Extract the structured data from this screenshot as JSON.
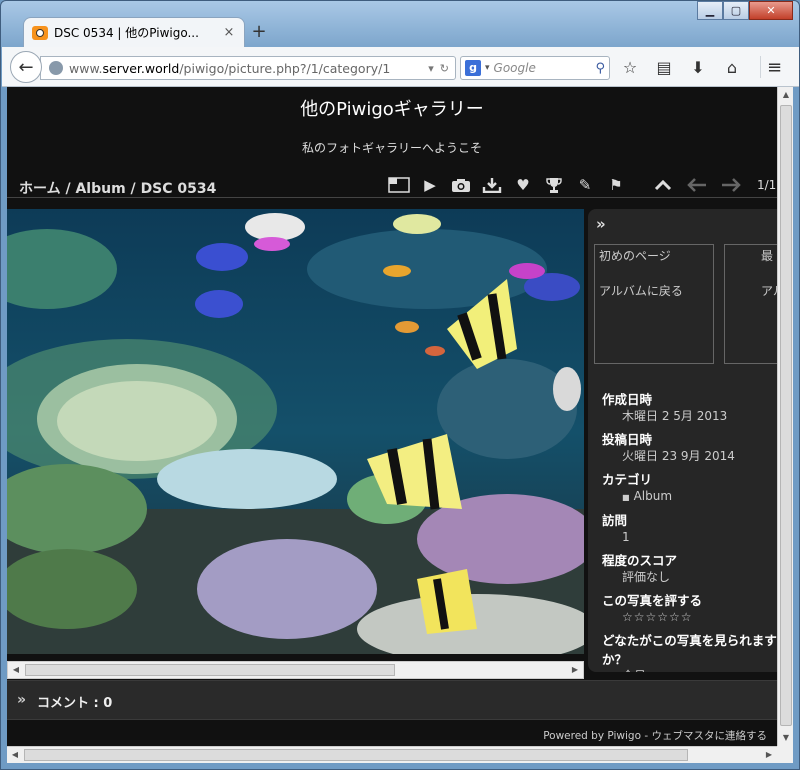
{
  "browser": {
    "tab_title": "DSC 0534 | 他のPiwigo...",
    "new_tab": "+",
    "tab_close": "×",
    "url_prefix": "www.",
    "url_host": "server.world",
    "url_path": "/piwigo/picture.php?/1/category/1",
    "search_engine_letter": "g",
    "search_placeholder": "Google",
    "window_min": "▁",
    "window_max": "▢",
    "window_close": "✕"
  },
  "site": {
    "title": "他のPiwigoギャラリー",
    "subtitle": "私のフォトギャラリーへようこそ"
  },
  "breadcrumb": {
    "home": "ホーム",
    "sep1": " / ",
    "album": "Album",
    "sep2": " / ",
    "current": "DSC 0534"
  },
  "nav": {
    "counter": "1/1"
  },
  "info_panel": {
    "first_page": "初めのページ",
    "back_to_album": "アルバムに戻る",
    "last_page": "最",
    "last_album": "アル",
    "created_label": "作成日時",
    "created_value": "木曜日 2 5月 2013",
    "posted_label": "投稿日時",
    "posted_value": "火曜日 23 9月 2014",
    "category_label": "カテゴリ",
    "category_value": "Album",
    "visits_label": "訪問",
    "visits_value": "1",
    "score_label": "程度のスコア",
    "score_value": "評価なし",
    "rate_label": "この写真を評する",
    "rate_stars": "☆☆☆☆☆☆",
    "who_label": "どなたがこの写真を見られますか？",
    "who_value": "全員"
  },
  "comments": {
    "label": "コメント : 0"
  },
  "footer": {
    "powered_by": "Powered by",
    "piwigo": "Piwigo",
    "sep": " - ",
    "contact": "ウェブマスタに連絡する"
  },
  "colors": {
    "page_bg": "#111111",
    "panel_bg": "#262626",
    "titlebar": "#6f9bc4"
  }
}
